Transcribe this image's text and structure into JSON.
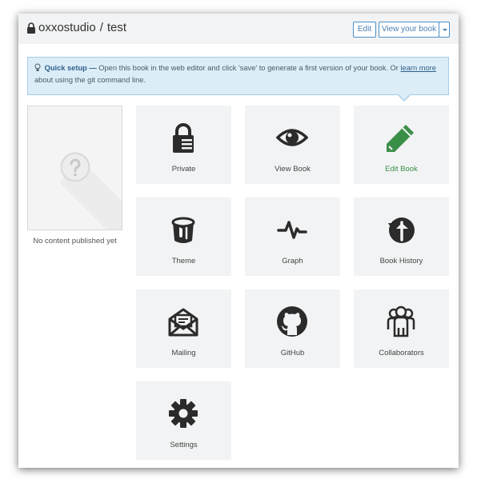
{
  "header": {
    "owner": "oxxostudio",
    "separator": "/",
    "repo": "test",
    "edit_label": "Edit",
    "view_label": "View your book"
  },
  "alert": {
    "heading": "Quick setup —",
    "text": "Open this book in the web editor and click 'save' to generate a first version of your book. Or",
    "link": "learn more",
    "text_after": "about using the git command line."
  },
  "cover": {
    "caption": "No content published yet"
  },
  "tiles": [
    {
      "label": "Private",
      "icon": "lock-icon"
    },
    {
      "label": "View Book",
      "icon": "eye-icon"
    },
    {
      "label": "Edit Book",
      "icon": "pencil-icon",
      "active": true
    },
    {
      "label": "Theme",
      "icon": "paint-bucket-icon"
    },
    {
      "label": "Graph",
      "icon": "pulse-icon"
    },
    {
      "label": "Book History",
      "icon": "history-icon"
    },
    {
      "label": "Mailing",
      "icon": "envelope-icon"
    },
    {
      "label": "GitHub",
      "icon": "github-icon"
    },
    {
      "label": "Collaborators",
      "icon": "users-icon"
    },
    {
      "label": "Settings",
      "icon": "gear-icon"
    }
  ],
  "colors": {
    "accent": "#4a90c8",
    "active": "#3a8f48",
    "icon": "#2b2b2b"
  }
}
